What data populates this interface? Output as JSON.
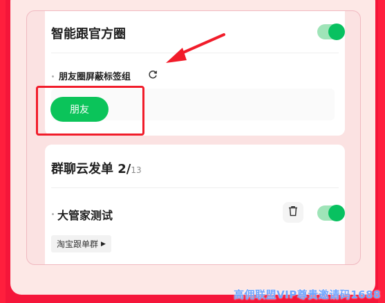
{
  "group1": {
    "title": "智能跟官方圈",
    "toggle_on": true,
    "row_label": "朋友圈屏蔽标签组",
    "tag_button": "朋友"
  },
  "group2": {
    "title_prefix": "群聊云发单 2/",
    "title_count": "13",
    "toggle_on": true,
    "row_label": "大管家测试",
    "chip_label": "淘宝跟单群"
  },
  "watermark": "高佣联盟VIP尊贵邀请码1688",
  "colors": {
    "accent_green": "#08c160",
    "annotation_red": "#f11c2a",
    "background_red": "#f5163a"
  },
  "icons": {
    "refresh": "refresh-icon",
    "trash": "trash-icon",
    "dropdown": "triangle-right-icon"
  }
}
